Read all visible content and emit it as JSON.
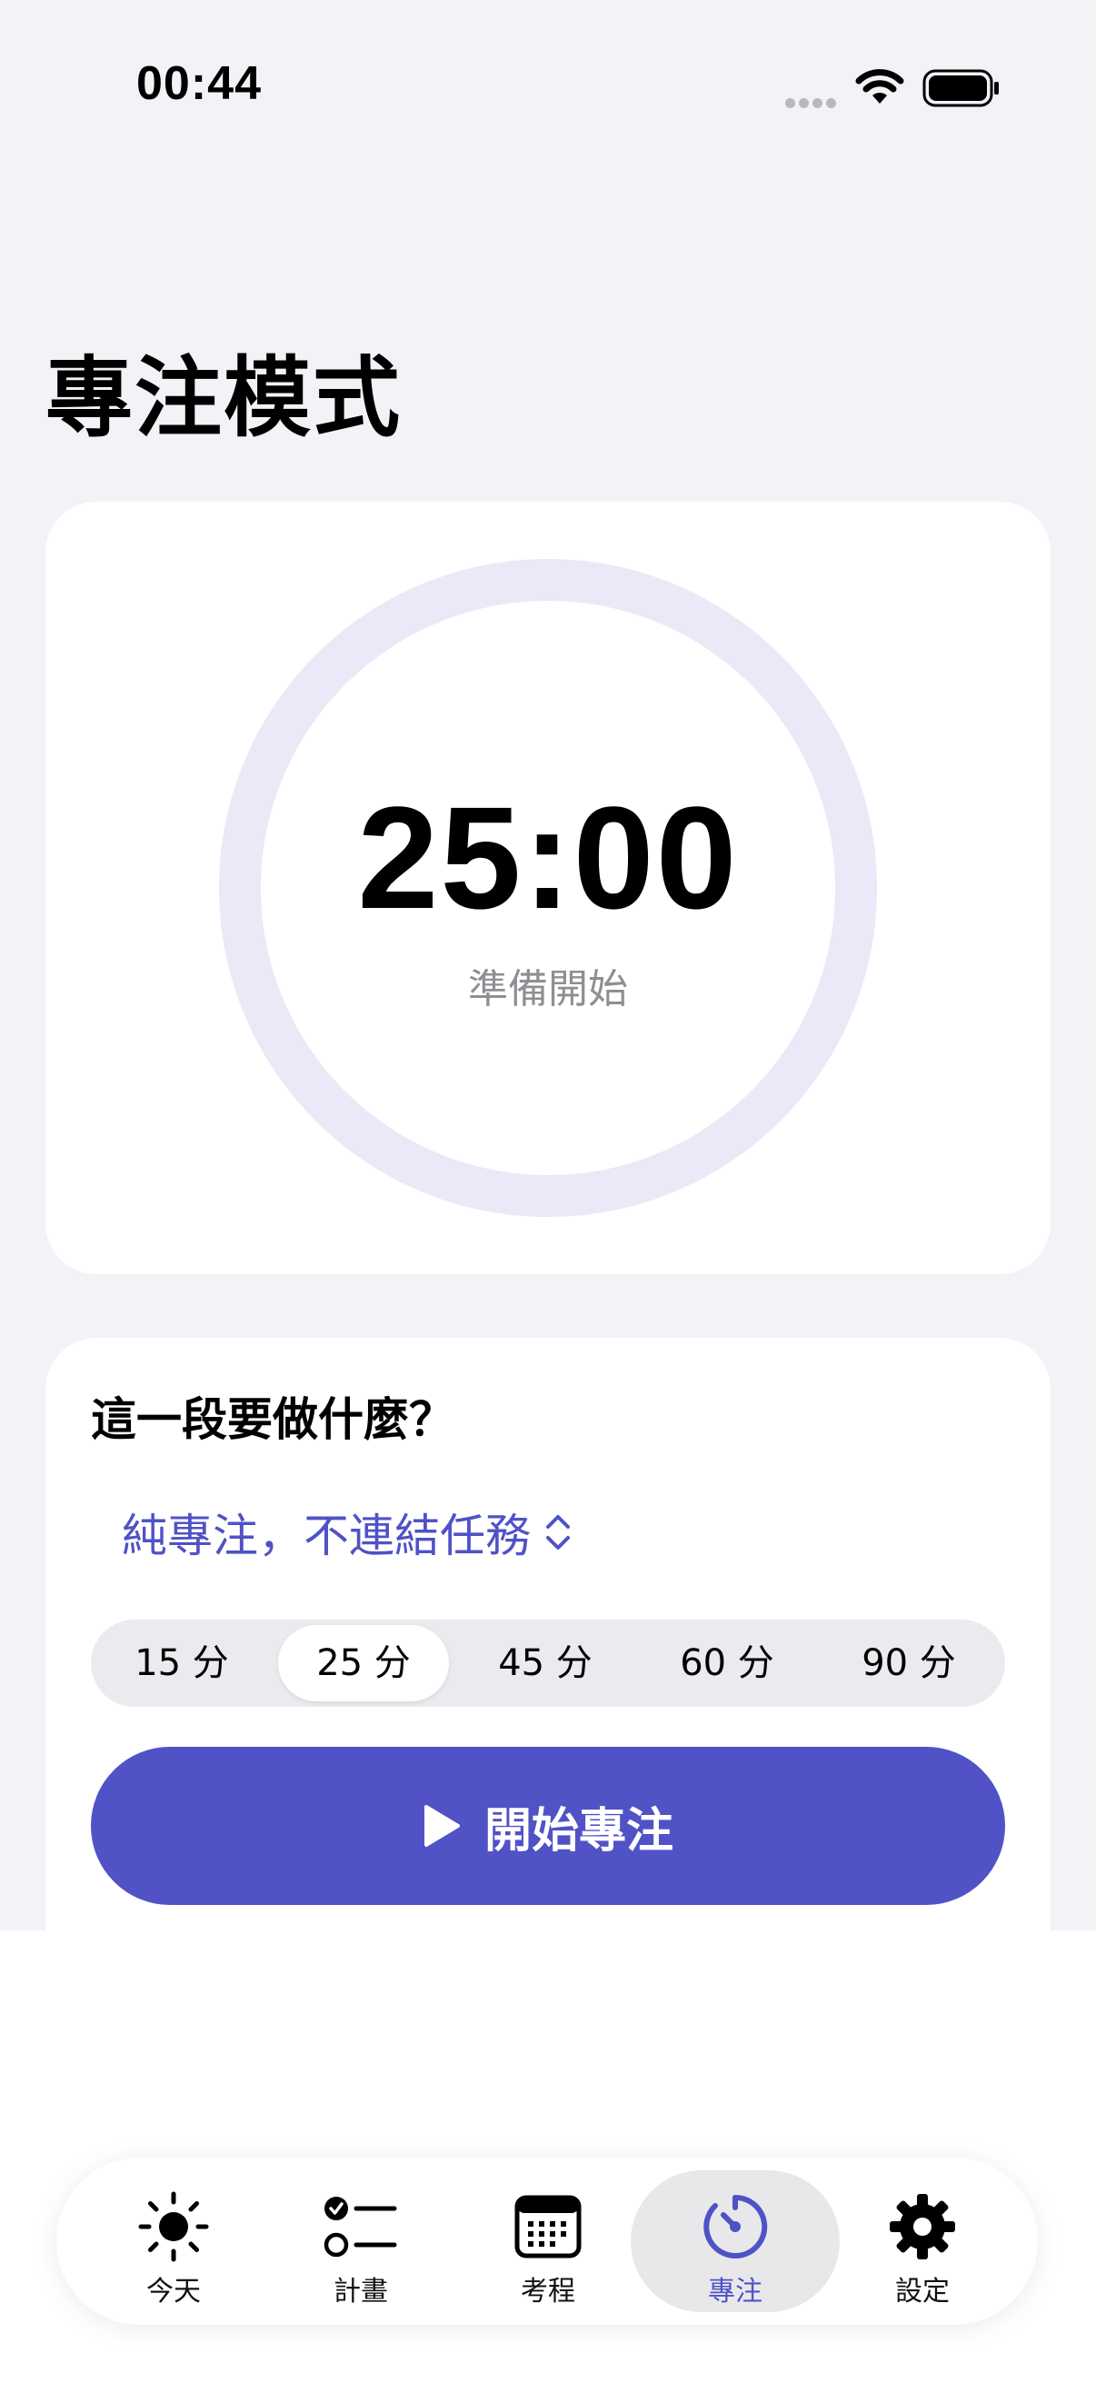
{
  "status_bar": {
    "time": "00:44"
  },
  "page": {
    "title": "專注模式"
  },
  "timer": {
    "value": "25:00",
    "status": "準備開始",
    "progress": 0
  },
  "setup": {
    "question": "這一段要做什麼？",
    "task_picker": "純專注，不連結任務",
    "durations": [
      "15 分",
      "25 分",
      "45 分",
      "60 分",
      "90 分"
    ],
    "selected_duration": "25 分",
    "start_label": "開始專注"
  },
  "tabs": [
    {
      "label": "今天",
      "icon": "sun-icon"
    },
    {
      "label": "計畫",
      "icon": "checklist-icon"
    },
    {
      "label": "考程",
      "icon": "calendar-icon"
    },
    {
      "label": "專注",
      "icon": "timer-icon",
      "active": true
    },
    {
      "label": "設定",
      "icon": "gear-icon"
    }
  ],
  "colors": {
    "accent": "#5052c6",
    "ring": "#e9e9f7",
    "background": "#f2f2f7"
  }
}
